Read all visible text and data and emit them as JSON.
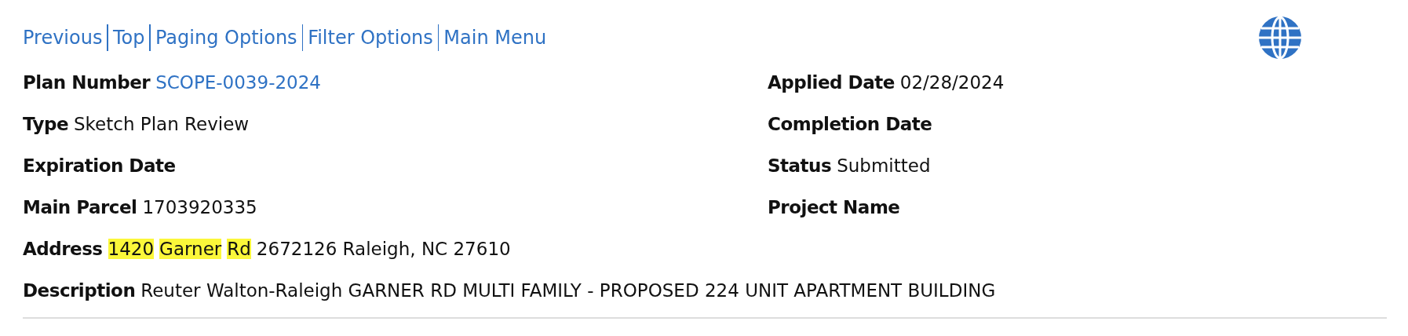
{
  "nav": [
    "Previous",
    "Top",
    "Paging Options",
    "Filter Options",
    "Main Menu"
  ],
  "fields": [
    {
      "label": "Plan Number",
      "value": "SCOPE-0039-2024",
      "link": true
    },
    {
      "label": "Applied Date",
      "value": "02/28/2024",
      "link": false
    },
    {
      "label": "Type",
      "value": "Sketch Plan Review",
      "link": false
    },
    {
      "label": "Completion Date"
    },
    {
      "label": "Expiration Date"
    },
    {
      "label": "Status",
      "value": "Submitted",
      "link": false
    },
    {
      "label": "Main Parcel",
      "value": "1703920335",
      "link": false
    },
    {
      "label": "Project Name"
    }
  ],
  "address": {
    "label": "Address",
    "parts": [
      {
        "text": "1420",
        "highlighted": true
      },
      {
        "text": "Garner",
        "highlighted": true
      },
      {
        "text": "Rd",
        "highlighted": true
      },
      {
        "text": "2672126 Raleigh, NC 27610",
        "highlighted": false
      }
    ]
  },
  "description": {
    "label": "Description",
    "value": "Reuter Walton-Raleigh GARNER RD MULTI FAMILY - PROPOSED 224 UNIT APARTMENT BUILDING"
  }
}
